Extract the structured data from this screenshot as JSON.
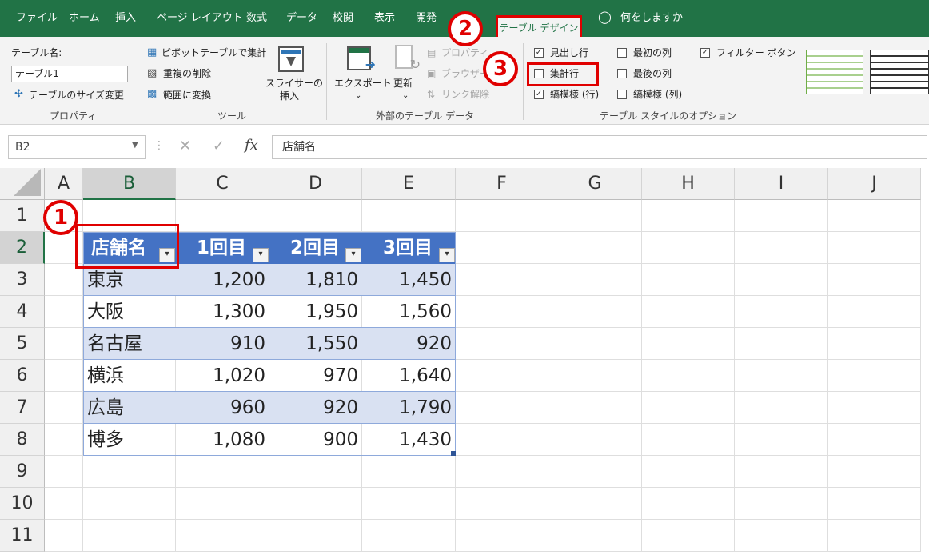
{
  "tabs": [
    "ファイル",
    "ホーム",
    "挿入",
    "ページ レイアウト",
    "数式",
    "データ",
    "校閲",
    "表示",
    "開発"
  ],
  "active_tab": "テーブル デザイン",
  "tell_me": "何をしますか",
  "ribbon": {
    "table_name_label": "テーブル名:",
    "table_name_value": "テーブル1",
    "resize": "テーブルのサイズ変更",
    "pivot": "ピボットテーブルで集計",
    "remove_dup": "重複の削除",
    "convert_range": "範囲に変換",
    "slicer": [
      "スライサーの",
      "挿入"
    ],
    "export": "エクスポート",
    "refresh": "更新",
    "properties": "プロパティ",
    "browser": "ブラウザーで",
    "unlink": "リンク解除",
    "header_row": "見出し行",
    "total_row": "集計行",
    "banded_rows": "縞模様 (行)",
    "first_col": "最初の列",
    "last_col": "最後の列",
    "banded_cols": "縞模様 (列)",
    "filter_btn": "フィルター ボタン",
    "groups": [
      "プロパティ",
      "ツール",
      "外部のテーブル データ",
      "テーブル スタイルのオプション"
    ]
  },
  "formula_bar": {
    "cell_ref": "B2",
    "value": "店舗名"
  },
  "columns": [
    "A",
    "B",
    "C",
    "D",
    "E",
    "F",
    "G",
    "H",
    "I",
    "J"
  ],
  "rows": [
    "1",
    "2",
    "3",
    "4",
    "5",
    "6",
    "7",
    "8",
    "9",
    "10",
    "11"
  ],
  "table": {
    "headers": [
      "店舗名",
      "1回目",
      "2回目",
      "3回目"
    ],
    "rows": [
      [
        "東京",
        "1,200",
        "1,810",
        "1,450"
      ],
      [
        "大阪",
        "1,300",
        "1,950",
        "1,560"
      ],
      [
        "名古屋",
        "910",
        "1,550",
        "920"
      ],
      [
        "横浜",
        "1,020",
        "970",
        "1,640"
      ],
      [
        "広島",
        "960",
        "920",
        "1,790"
      ],
      [
        "博多",
        "1,080",
        "900",
        "1,430"
      ]
    ]
  },
  "callouts": [
    "1",
    "2",
    "3"
  ],
  "colors": {
    "excel_green": "#217346",
    "table_header": "#4472c4",
    "band": "#d9e1f2",
    "highlight": "#e00000"
  }
}
